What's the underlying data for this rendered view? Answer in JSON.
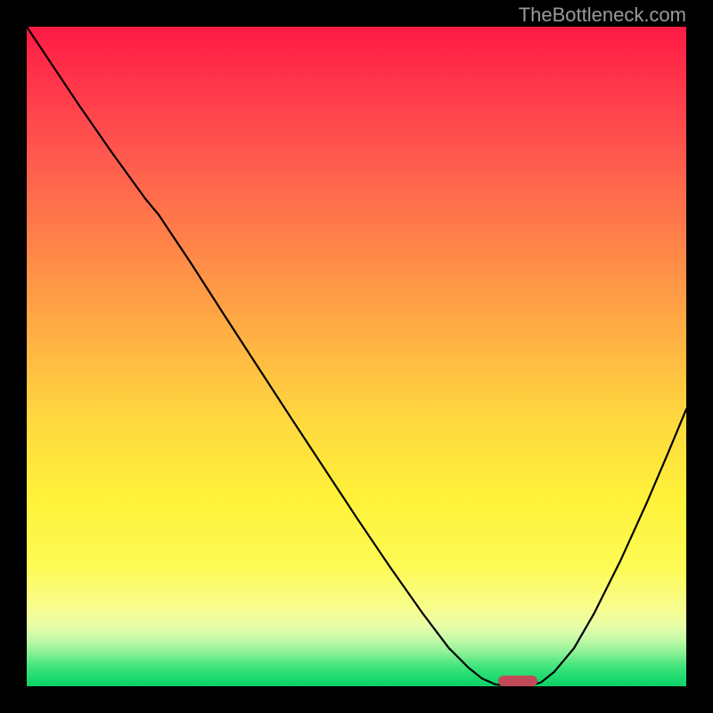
{
  "watermark": "TheBottleneck.com",
  "chart_data": {
    "type": "line",
    "title": "",
    "xlabel": "",
    "ylabel": "",
    "x": [
      0.0,
      0.03,
      0.08,
      0.13,
      0.18,
      0.2,
      0.22,
      0.25,
      0.3,
      0.35,
      0.4,
      0.45,
      0.5,
      0.55,
      0.6,
      0.64,
      0.67,
      0.69,
      0.71,
      0.735,
      0.76,
      0.78,
      0.8,
      0.83,
      0.86,
      0.9,
      0.94,
      0.97,
      1.0
    ],
    "values": [
      1.0,
      0.955,
      0.88,
      0.808,
      0.739,
      0.715,
      0.685,
      0.64,
      0.562,
      0.485,
      0.408,
      0.332,
      0.256,
      0.182,
      0.111,
      0.058,
      0.028,
      0.012,
      0.003,
      0.0,
      0.0,
      0.006,
      0.022,
      0.058,
      0.11,
      0.19,
      0.278,
      0.348,
      0.42
    ],
    "xlim": [
      0,
      1
    ],
    "ylim": [
      0,
      1
    ],
    "marker": {
      "x_center": 0.745,
      "width": 0.06,
      "y": 0.0
    },
    "colors": {
      "curve": "#000000",
      "marker": "#c14a58",
      "gradient_top": "#ff1a44",
      "gradient_bottom": "#0fd066"
    }
  }
}
